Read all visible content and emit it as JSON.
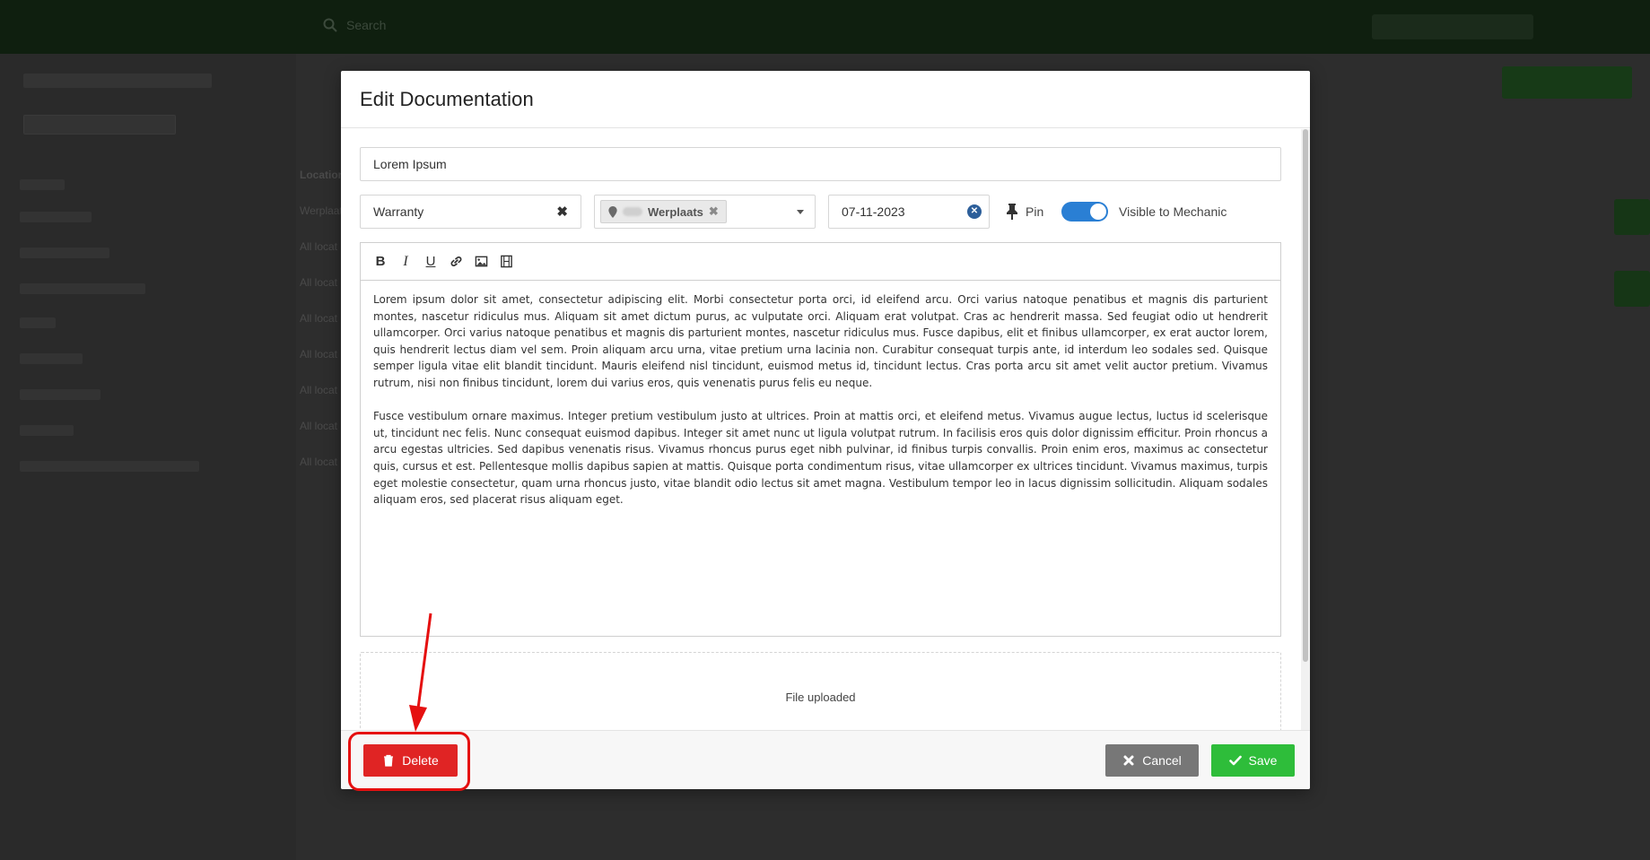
{
  "app": {
    "search_placeholder": "Search",
    "table_header": "Location",
    "table_cells": [
      "Werplaats",
      "All locat",
      "All locat",
      "All locat",
      "All locat",
      "All locat",
      "All locat",
      "All locat"
    ]
  },
  "modal": {
    "title": "Edit Documentation",
    "title_field": {
      "value": "Lorem Ipsum"
    },
    "category_field": {
      "value": "Warranty",
      "clear_icon": "close-icon"
    },
    "location_field": {
      "tag_label": "Werplaats",
      "tag_icon": "map-pin-icon",
      "remove_icon": "close-icon",
      "dropdown_icon": "caret-down-icon"
    },
    "date_field": {
      "value": "07-11-2023",
      "clear_icon": "close-icon"
    },
    "pin": {
      "label": "Pin",
      "icon": "thumbtack-icon"
    },
    "visible_toggle": {
      "label": "Visible to Mechanic",
      "checked": true,
      "color": "#2a7fd4"
    },
    "editor": {
      "toolbar": [
        "bold",
        "italic",
        "underline",
        "link",
        "image",
        "video"
      ],
      "paragraphs": [
        "Lorem ipsum dolor sit amet, consectetur adipiscing elit. Morbi consectetur porta orci, id eleifend arcu. Orci varius natoque penatibus et magnis dis parturient montes, nascetur ridiculus mus. Aliquam sit amet dictum purus, ac vulputate orci. Aliquam erat volutpat. Cras ac hendrerit massa. Sed feugiat odio ut hendrerit ullamcorper. Orci varius natoque penatibus et magnis dis parturient montes, nascetur ridiculus mus. Fusce dapibus, elit et finibus ullamcorper, ex erat auctor lorem, quis hendrerit lectus diam vel sem. Proin aliquam arcu urna, vitae pretium urna lacinia non. Curabitur consequat turpis ante, id interdum leo sodales sed. Quisque semper ligula vitae elit blandit tincidunt. Mauris eleifend nisl tincidunt, euismod metus id, tincidunt lectus. Cras porta arcu sit amet velit auctor pretium. Vivamus rutrum, nisi non finibus tincidunt, lorem dui varius eros, quis venenatis purus felis eu neque.",
        "Fusce vestibulum ornare maximus. Integer pretium vestibulum justo at ultrices. Proin at mattis orci, et eleifend metus. Vivamus augue lectus, luctus id scelerisque ut, tincidunt nec felis. Nunc consequat euismod dapibus. Integer sit amet nunc ut ligula volutpat rutrum. In facilisis eros quis dolor dignissim efficitur. Proin rhoncus a arcu egestas ultricies. Sed dapibus venenatis risus. Vivamus rhoncus purus eget nibh pulvinar, id finibus turpis convallis. Proin enim eros, maximus ac consectetur quis, cursus et est. Pellentesque mollis dapibus sapien at mattis. Quisque porta condimentum risus, vitae ullamcorper ex ultrices tincidunt. Vivamus maximus, turpis eget molestie consectetur, quam urna rhoncus justo, vitae blandit odio lectus sit amet magna. Vestibulum tempor leo in lacus dignissim sollicitudin. Aliquam sodales aliquam eros, sed placerat risus aliquam eget."
      ]
    },
    "upload": {
      "status": "File uploaded"
    },
    "footer": {
      "delete": {
        "label": "Delete",
        "icon": "trash-icon",
        "color": "#e02424"
      },
      "cancel": {
        "label": "Cancel",
        "icon": "close-icon",
        "color": "#777777"
      },
      "save": {
        "label": "Save",
        "icon": "check-icon",
        "color": "#2ebd3a"
      }
    }
  },
  "annotation": {
    "color": "#e51010",
    "target": "delete-button"
  }
}
